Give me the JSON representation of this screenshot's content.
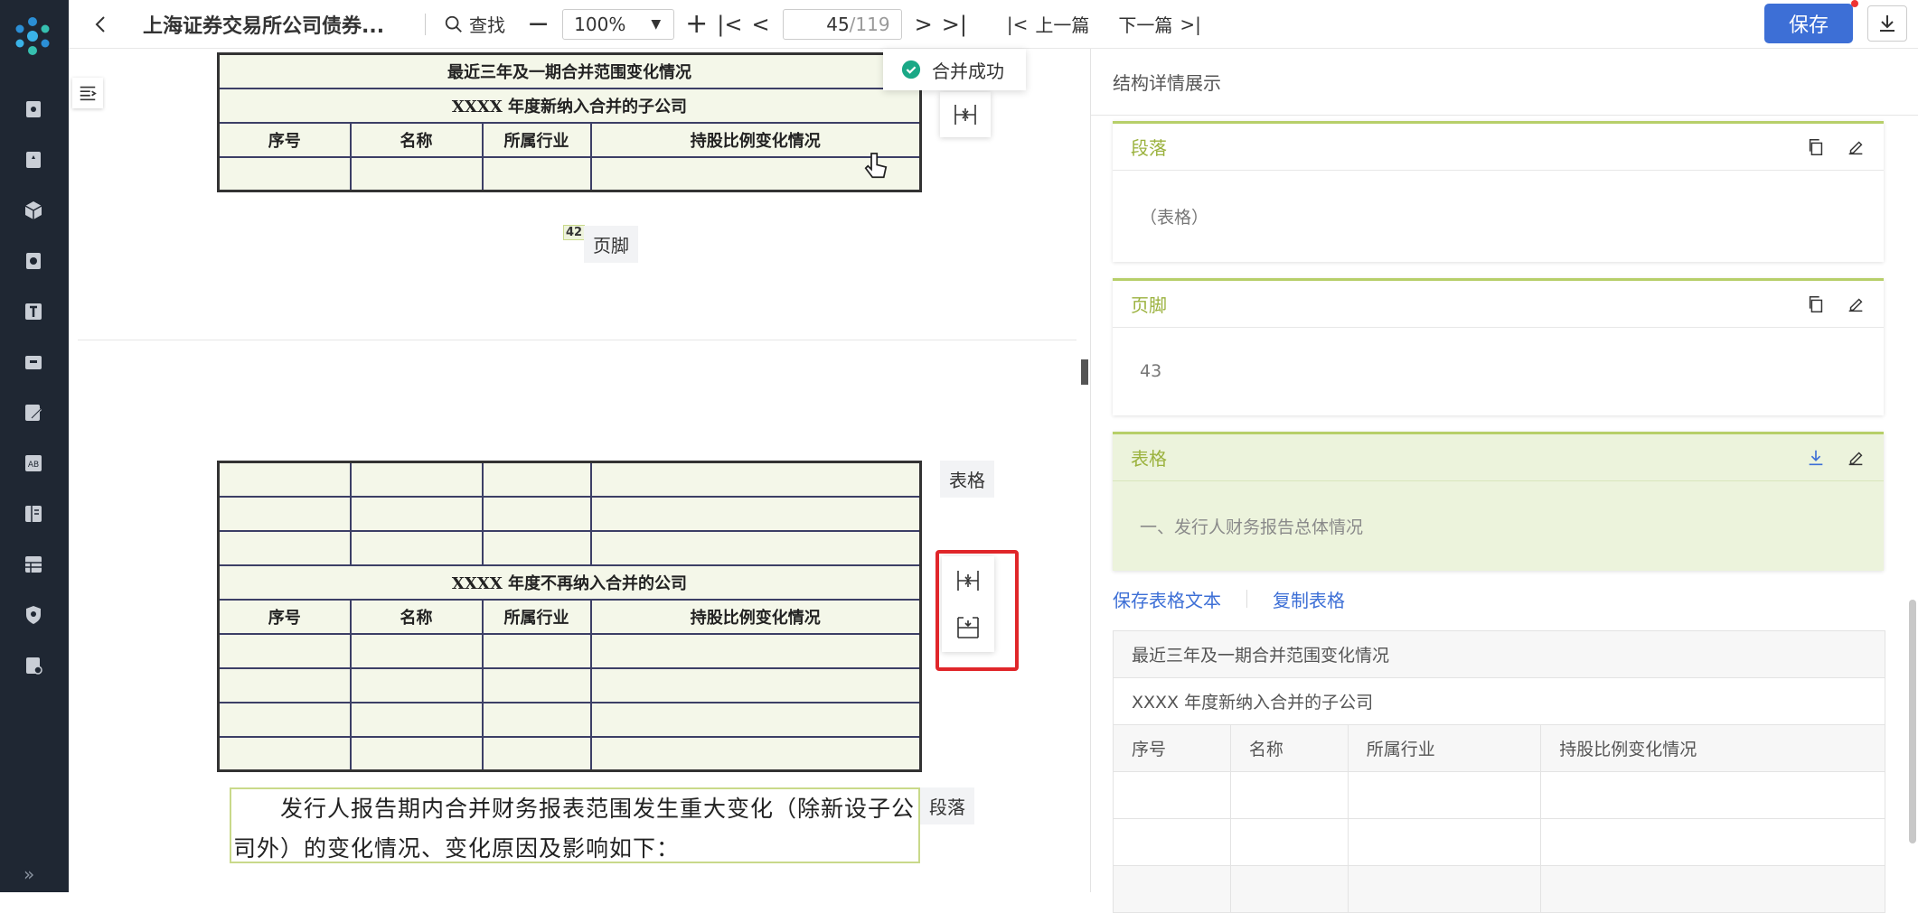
{
  "topbar": {
    "title": "上海证券交易所公司债券...",
    "search_label": "查找",
    "zoom": "100%",
    "page_current": "45",
    "page_total": "/119",
    "prev_doc": "上一篇",
    "next_doc": "下一篇",
    "save_label": "保存"
  },
  "toast": {
    "text": "合并成功"
  },
  "doc": {
    "table1": {
      "title": "最近三年及一期合并范围变化情况",
      "subtitle": "XXXX 年度新纳入合并的子公司",
      "headers": [
        "序号",
        "名称",
        "所属行业",
        "持股比例变化情况"
      ]
    },
    "footer_page_num": "42",
    "footer_tag": "页脚",
    "table2": {
      "title": "XXXX 年度不再纳入合并的公司",
      "headers": [
        "序号",
        "名称",
        "所属行业",
        "持股比例变化情况"
      ]
    },
    "table_tag": "表格",
    "para_tag": "段落",
    "para_text": "发行人报告期内合并财务报表范围发生重大变化（除新设子公司外）的变化情况、变化原因及影响如下："
  },
  "right": {
    "header": "结构详情展示",
    "cards": [
      {
        "type": "段落",
        "content": "（表格）"
      },
      {
        "type": "页脚",
        "content": "43"
      },
      {
        "type": "表格",
        "content": "一、发行人财务报告总体情况"
      }
    ],
    "links": [
      "保存表格文本",
      "复制表格"
    ],
    "table": {
      "row1": "最近三年及一期合并范围变化情况",
      "row2": "XXXX 年度新纳入合并的子公司",
      "headers": [
        "序号",
        "名称",
        "所属行业",
        "持股比例变化情况"
      ]
    }
  },
  "colors": {
    "accent": "#3d6fd6",
    "sidebar": "#1f2733",
    "card_green": "#9bb23e",
    "highlight": "#e0262a"
  }
}
